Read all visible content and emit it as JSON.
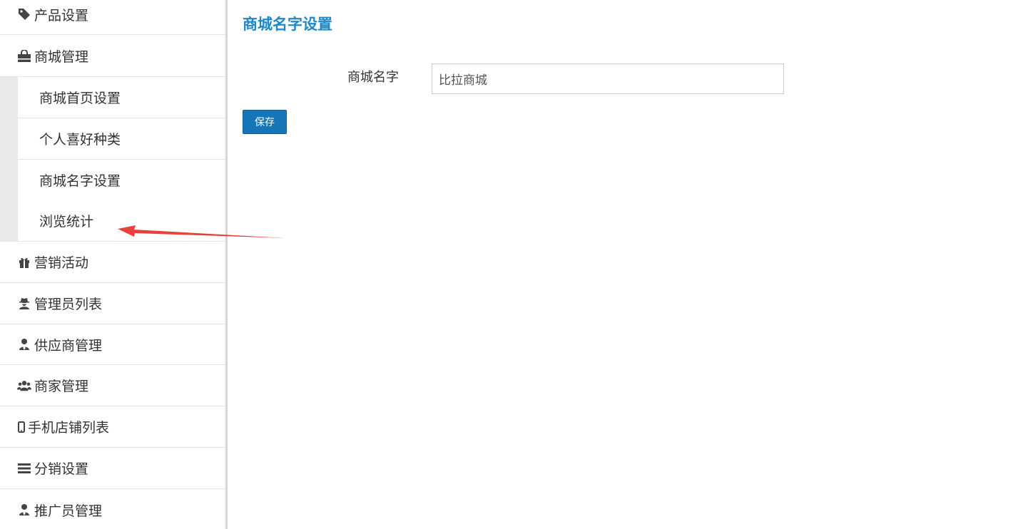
{
  "sidebar": {
    "items": [
      {
        "label": "产品设置",
        "icon": "tag-icon"
      },
      {
        "label": "商城管理",
        "icon": "shopping-bag-icon"
      },
      {
        "label": "营销活动",
        "icon": "gift-icon"
      },
      {
        "label": "管理员列表",
        "icon": "user-secret-icon"
      },
      {
        "label": "供应商管理",
        "icon": "user-tie-icon"
      },
      {
        "label": "商家管理",
        "icon": "users-icon"
      },
      {
        "label": "手机店铺列表",
        "icon": "mobile-icon"
      },
      {
        "label": "分销设置",
        "icon": "menu-bars-icon"
      },
      {
        "label": "推广员管理",
        "icon": "user-tie-icon"
      }
    ],
    "sub_items": [
      {
        "label": "商城首页设置"
      },
      {
        "label": "个人喜好种类"
      },
      {
        "label": "商城名字设置"
      },
      {
        "label": "浏览统计"
      }
    ]
  },
  "main": {
    "title": "商城名字设置",
    "form": {
      "label": "商城名字",
      "value": "比拉商城"
    },
    "save_label": "保存"
  },
  "colors": {
    "title": "#1e88c8",
    "button": "#1476b8",
    "arrow": "#e8403a",
    "sub_group_bg": "#e9e9e9"
  }
}
